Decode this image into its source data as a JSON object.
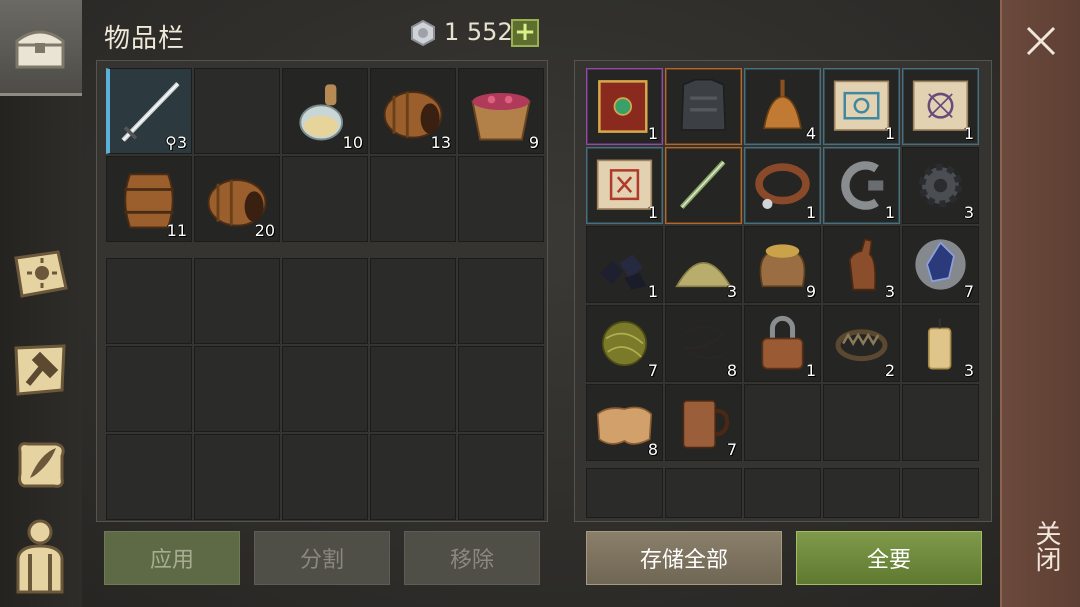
{
  "header": {
    "title": "物品栏",
    "coins": "1 552",
    "plus": "+"
  },
  "left_inventory": {
    "rows": [
      [
        {
          "icon": "sword-icon",
          "count": "3",
          "extra": "⚲"
        },
        {
          "icon": ""
        },
        {
          "icon": "potion-icon",
          "count": "10"
        },
        {
          "icon": "barrel-side-icon",
          "count": "13"
        },
        {
          "icon": "berry-bowl-icon",
          "count": "9"
        }
      ],
      [
        {
          "icon": "barrel-icon",
          "count": "11"
        },
        {
          "icon": "barrel-side-icon",
          "count": "20"
        },
        {
          "icon": ""
        },
        {
          "icon": ""
        },
        {
          "icon": ""
        }
      ]
    ]
  },
  "buttons": {
    "apply": "应用",
    "split": "分割",
    "remove": "移除",
    "store_all": "存储全部",
    "take_all": "全要"
  },
  "right_inventory": {
    "rows": [
      [
        {
          "icon": "spell-book-icon",
          "count": "1",
          "rarity": "p"
        },
        {
          "icon": "armor-icon",
          "count": "",
          "rarity": "o"
        },
        {
          "icon": "bell-icon",
          "count": "4",
          "rarity": "g"
        },
        {
          "icon": "blue-scroll-icon",
          "count": "1",
          "rarity": "g"
        },
        {
          "icon": "purple-scroll-icon",
          "count": "1",
          "rarity": "g"
        }
      ],
      [
        {
          "icon": "red-scroll-icon",
          "count": "1",
          "rarity": "g"
        },
        {
          "icon": "dagger-icon",
          "count": "",
          "rarity": "o"
        },
        {
          "icon": "collar-icon",
          "count": "1",
          "rarity": "g"
        },
        {
          "icon": "clamp-icon",
          "count": "1",
          "rarity": "g"
        },
        {
          "icon": "gear-icon",
          "count": "3",
          "rarity": ""
        }
      ],
      [
        {
          "icon": "coal-icon",
          "count": "1"
        },
        {
          "icon": "sand-pile-icon",
          "count": "3"
        },
        {
          "icon": "sack-icon",
          "count": "9"
        },
        {
          "icon": "bottle-icon",
          "count": "3"
        },
        {
          "icon": "crystal-icon",
          "count": "7"
        }
      ],
      [
        {
          "icon": "fiber-ball-icon",
          "count": "7"
        },
        {
          "icon": "wire-icon",
          "count": "8"
        },
        {
          "icon": "padlock-icon",
          "count": "1"
        },
        {
          "icon": "bear-trap-icon",
          "count": "2"
        },
        {
          "icon": "candle-icon",
          "count": "3"
        }
      ],
      [
        {
          "icon": "leather-icon",
          "count": "8"
        },
        {
          "icon": "mug-icon",
          "count": "7"
        },
        {
          "icon": ""
        },
        {
          "icon": ""
        },
        {
          "icon": ""
        }
      ]
    ]
  },
  "close": {
    "label": "关闭"
  },
  "sidebar": {
    "items": [
      "chest-icon",
      "sun-book-icon",
      "crafting-hammer-icon",
      "quill-scroll-icon",
      "character-icon"
    ]
  }
}
